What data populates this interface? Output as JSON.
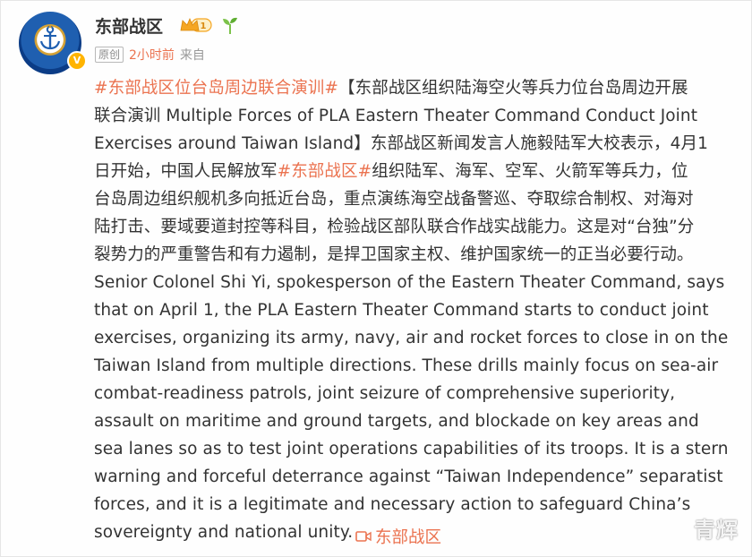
{
  "author": {
    "name": "东部战区",
    "level_badge": "1",
    "avatar_text": "东部战区"
  },
  "meta": {
    "tag": "原创",
    "time": "2小时前",
    "source": "来自"
  },
  "content": {
    "lines": [
      [
        {
          "t": "#东部战区位台岛周边联合演训#",
          "topic": true
        },
        {
          "t": "【东部战区组织陆海空火等兵力位台岛周边开展"
        }
      ],
      [
        {
          "t": "联合演训 Multiple Forces of PLA Eastern Theater Command Conduct Joint"
        }
      ],
      [
        {
          "t": "Exercises around Taiwan Island】东部战区新闻发言人施毅陆军大校表示，4月1"
        }
      ],
      [
        {
          "t": "日开始，中国人民解放军"
        },
        {
          "t": "#东部战区#",
          "topic": true
        },
        {
          "t": "组织陆军、海军、空军、火箭军等兵力，位"
        }
      ],
      [
        {
          "t": "台岛周边组织舰机多向抵近台岛，重点演练海空战备警巡、夺取综合制权、对海对"
        }
      ],
      [
        {
          "t": "陆打击、要域要道封控等科目，检验战区部队联合作战实战能力。这是对“台独”分"
        }
      ],
      [
        {
          "t": "裂势力的严重警告和有力遏制，是捍卫国家主权、维护国家统一的正当必要行动。"
        }
      ],
      [
        {
          "t": "Senior Colonel Shi Yi, spokesperson of the Eastern Theater Command, says"
        }
      ],
      [
        {
          "t": "that on April 1, the PLA Eastern Theater Command starts to conduct joint"
        }
      ],
      [
        {
          "t": "exercises, organizing its army, navy, air and rocket forces to close in on the"
        }
      ],
      [
        {
          "t": "Taiwan Island from multiple directions. These drills mainly focus on sea-air"
        }
      ],
      [
        {
          "t": "combat-readiness patrols, joint seizure of comprehensive superiority,"
        }
      ],
      [
        {
          "t": "assault on maritime and ground targets, and blockade on key areas and"
        }
      ],
      [
        {
          "t": "sea lanes so as to test joint operations capabilities of its troops. It is a stern"
        }
      ],
      [
        {
          "t": "warning and forceful deterrance against “Taiwan Independence” separatist"
        }
      ],
      [
        {
          "t": "forces, and it is a legitimate and necessary action to safeguard China’s"
        }
      ],
      [
        {
          "t": "sovereignty and national unity."
        }
      ]
    ],
    "video_link": "东部战区"
  },
  "watermark": "青辉",
  "colors": {
    "accent": "#eb7350",
    "text": "#333333",
    "muted": "#999999",
    "badge_gold": "#f5a623"
  }
}
